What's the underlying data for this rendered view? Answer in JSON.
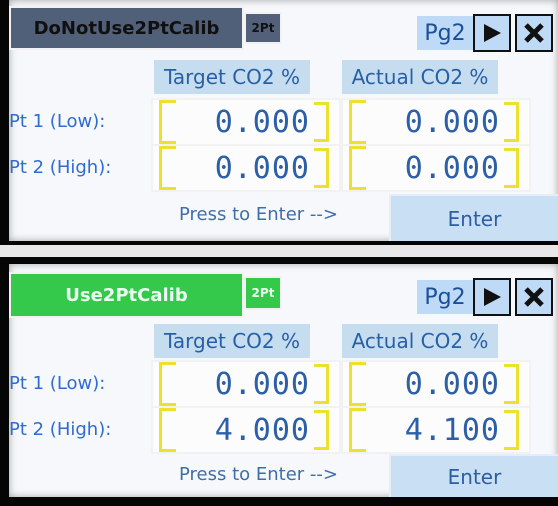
{
  "panels": [
    {
      "mode_button": "DoNotUse2PtCalib",
      "mode_badge": "2Pt",
      "page_label": "Pg2",
      "headers": [
        "Target CO2 %",
        "Actual CO2 %"
      ],
      "rows": [
        {
          "label": "Pt 1 (Low):",
          "target": "0.000",
          "actual": "0.000"
        },
        {
          "label": "Pt 2 (High):",
          "target": "0.000",
          "actual": "0.000"
        }
      ],
      "hint": "Press to Enter -->",
      "enter_label": "Enter"
    },
    {
      "mode_button": "Use2PtCalib",
      "mode_badge": "2Pt",
      "page_label": "Pg2",
      "headers": [
        "Target CO2 %",
        "Actual CO2 %"
      ],
      "rows": [
        {
          "label": "Pt 1 (Low):",
          "target": "0.000",
          "actual": "0.000"
        },
        {
          "label": "Pt 2 (High):",
          "target": "4.000",
          "actual": "4.100"
        }
      ],
      "hint": "Press to Enter -->",
      "enter_label": "Enter"
    }
  ],
  "icons": {
    "next": "play-right-icon",
    "close": "close-x-icon"
  },
  "colors": {
    "off_mode": "#506078",
    "on_mode": "#35c94b",
    "accent": "#ece22e"
  }
}
